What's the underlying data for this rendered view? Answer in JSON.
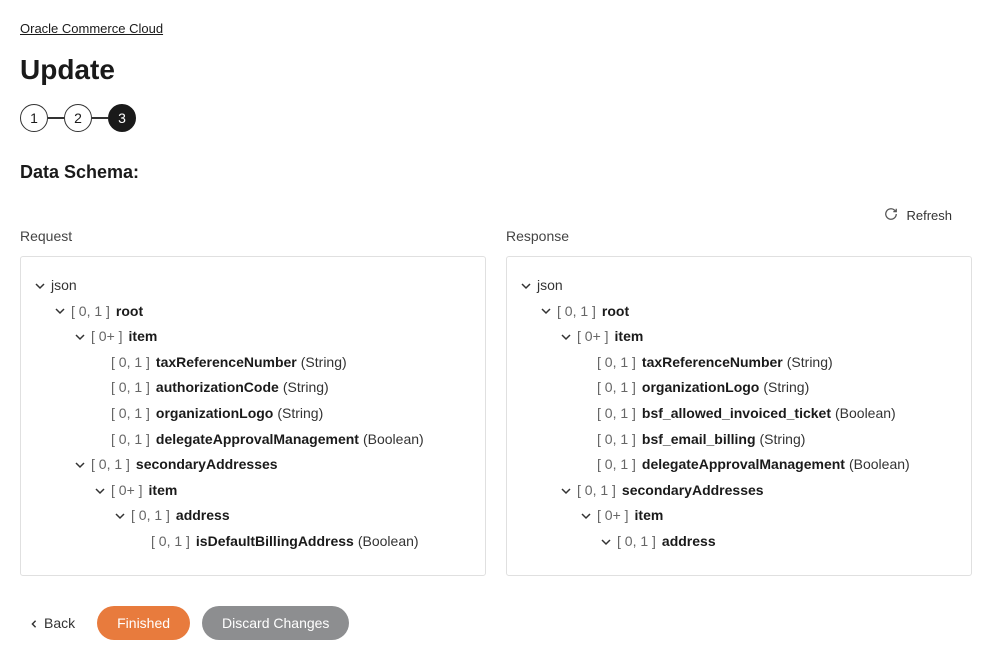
{
  "breadcrumb": "Oracle Commerce Cloud",
  "title": "Update",
  "stepper": {
    "steps": [
      "1",
      "2",
      "3"
    ],
    "activeIndex": 2
  },
  "sectionTitle": "Data Schema:",
  "refreshLabel": "Refresh",
  "columns": {
    "request": {
      "header": "Request"
    },
    "response": {
      "header": "Response"
    }
  },
  "schema": {
    "jsonLabel": "json",
    "rootLabel": "root",
    "itemLabel": "item",
    "secondaryAddressesLabel": "secondaryAddresses",
    "addressLabel": "address",
    "card01": "[ 0, 1 ]",
    "card0p": "[ 0+ ]"
  },
  "requestFields": {
    "f0": {
      "name": "taxReferenceNumber",
      "type": "(String)"
    },
    "f1": {
      "name": "authorizationCode",
      "type": "(String)"
    },
    "f2": {
      "name": "organizationLogo",
      "type": "(String)"
    },
    "f3": {
      "name": "delegateApprovalManagement",
      "type": "(Boolean)"
    },
    "f4": {
      "name": "isDefaultBillingAddress",
      "type": "(Boolean)"
    }
  },
  "responseFields": {
    "f0": {
      "name": "taxReferenceNumber",
      "type": "(String)"
    },
    "f1": {
      "name": "organizationLogo",
      "type": "(String)"
    },
    "f2": {
      "name": "bsf_allowed_invoiced_ticket",
      "type": "(Boolean)"
    },
    "f3": {
      "name": "bsf_email_billing",
      "type": "(String)"
    },
    "f4": {
      "name": "delegateApprovalManagement",
      "type": "(Boolean)"
    }
  },
  "footer": {
    "back": "Back",
    "finished": "Finished",
    "discard": "Discard Changes"
  }
}
